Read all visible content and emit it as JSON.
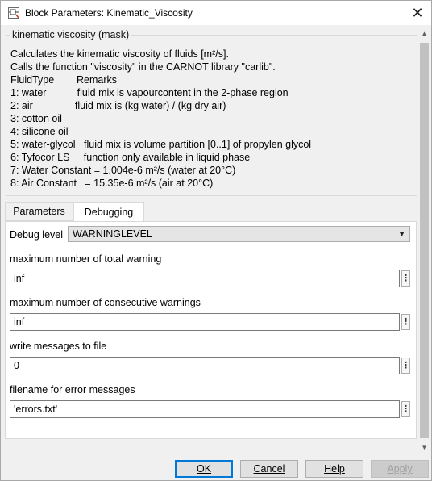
{
  "window": {
    "title": "Block Parameters: Kinematic_Viscosity",
    "close_symbol": "✕"
  },
  "group": {
    "legend": "kinematic viscosity (mask)",
    "description_lines": [
      "Calculates the kinematic viscosity of fluids [m²/s].",
      "Calls the function \"viscosity\" in the CARNOT library \"carlib\".",
      "FluidType        Remarks",
      "1: water           fluid mix is vapourcontent in the 2-phase region",
      "2: air               fluid mix is (kg water) / (kg dry air)",
      "3: cotton oil        -",
      "4: silicone oil     -",
      "5: water-glycol   fluid mix is volume partition [0..1] of propylen glycol",
      "6: Tyfocor LS     function only available in liquid phase",
      "7: Water Constant = 1.004e-6 m²/s (water at 20°C)",
      "8: Air Constant   = 15.35e-6 m²/s (air at 20°C)"
    ]
  },
  "tabs": [
    {
      "label": "Parameters",
      "active": false
    },
    {
      "label": "Debugging",
      "active": true
    }
  ],
  "debugging": {
    "debug_level_label": "Debug level",
    "debug_level_value": "WARNINGLEVEL",
    "fields": [
      {
        "label": "maximum number of total warning",
        "value": "inf"
      },
      {
        "label": "maximum number of consecutive warnings",
        "value": "inf"
      },
      {
        "label": "write messages to file",
        "value": "0"
      },
      {
        "label": "filename for error messages",
        "value": "'errors.txt'"
      }
    ],
    "more_symbol": "⋮"
  },
  "buttons": {
    "ok": "OK",
    "cancel": "Cancel",
    "help": "Help",
    "apply": "Apply"
  },
  "icons": {
    "app": "simulink-block-icon",
    "close": "close-icon",
    "dropdown": "chevron-down-icon",
    "scroll_up": "scroll-up-icon",
    "scroll_down": "scroll-down-icon"
  }
}
